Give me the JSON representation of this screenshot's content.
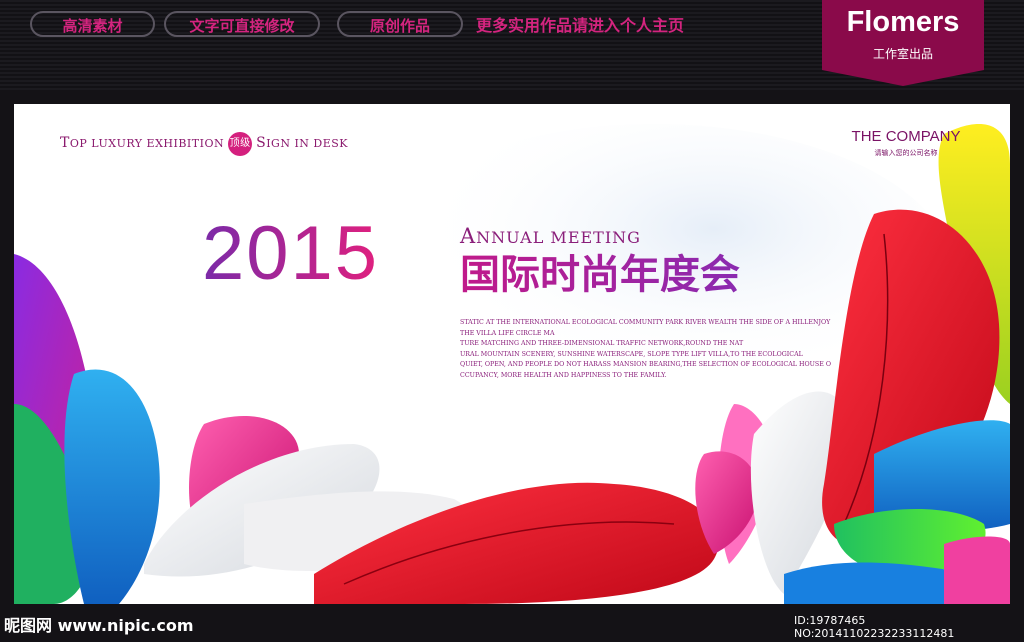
{
  "topbar": {
    "pills": [
      "高清素材",
      "文字可直接修改",
      "原创作品"
    ],
    "promo": "更多实用作品请进入个人主页"
  },
  "brand": {
    "name": "Flomers",
    "subtitle": "工作室出品"
  },
  "poster": {
    "tagline": {
      "part1_big": "T",
      "part1_rest": "op luxury exhibition",
      "badge": "顶级",
      "part2_big": "S",
      "part2_rest": "ign in desk"
    },
    "company": "THE COMPANY",
    "company_sub": "请输入您的公司名称",
    "year": "2015",
    "annual_big": "A",
    "annual_rest": "nnual meeting",
    "title_cn": "国际时尚年度会",
    "description": [
      "STATIC AT THE INTERNATIONAL ECOLOGICAL COMMUNITY PARK RIVER WEALTH THE SIDE OF A HILLENJOY",
      "THE VILLA LIFE CIRCLE MA",
      "TURE MATCHING AND THREE-DIMENSIONAL TRAFFIC NETWORK,ROUND THE NAT",
      "URAL MOUNTAIN SCENERY, SUNSHINE WATERSCAPE, SLOPE TYPE LIFT VILLA,TO THE ECOLOGICAL",
      "QUIET, OPEN, AND PEOPLE DO NOT HARASS MANSION BEARING,THE SELECTION OF ECOLOGICAL HOUSE O",
      "CCUPANCY, MORE HEALTH AND HAPPINESS TO THE FAMILY."
    ]
  },
  "footer": {
    "site": "昵图网 www.nipic.com",
    "id_text": "ID:19787465 NO:20141102232233112481"
  },
  "colors": {
    "accent": "#d4247f",
    "brand_bg": "#8a0a4a",
    "title": "#8a1e7a"
  }
}
